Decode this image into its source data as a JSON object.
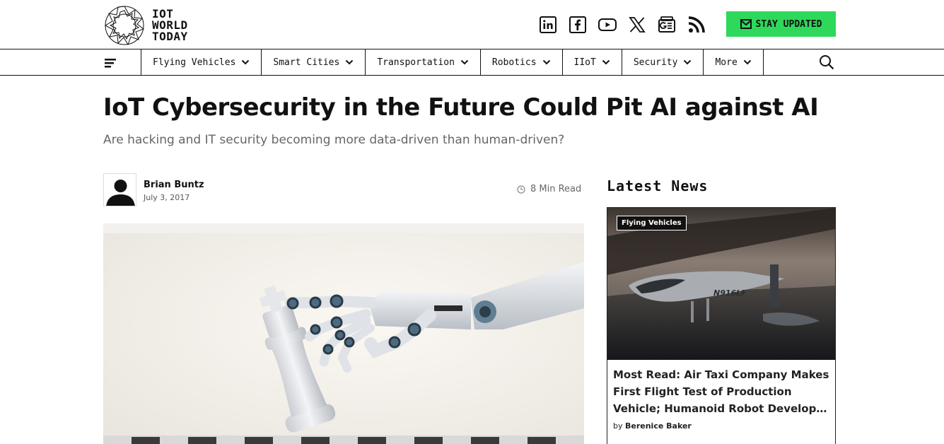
{
  "brand": {
    "logo_lines": [
      "IOT",
      "WORLD",
      "TODAY"
    ]
  },
  "socials": [
    {
      "icon": "linkedin-icon"
    },
    {
      "icon": "facebook-icon"
    },
    {
      "icon": "youtube-icon"
    },
    {
      "icon": "x-icon"
    },
    {
      "icon": "google-news-icon"
    },
    {
      "icon": "rss-icon"
    }
  ],
  "stay_updated": {
    "label": "STAY UPDATED",
    "color": "#2ed85b"
  },
  "nav": {
    "items": [
      {
        "label": "Flying Vehicles"
      },
      {
        "label": "Smart Cities"
      },
      {
        "label": "Transportation"
      },
      {
        "label": "Robotics"
      },
      {
        "label": "IIoT"
      },
      {
        "label": "Security"
      },
      {
        "label": "More"
      }
    ]
  },
  "article": {
    "title": "IoT Cybersecurity in the Future Could Pit AI against AI",
    "subtitle": "Are hacking and IT security becoming more data-driven than human-driven?",
    "author": "Brian Buntz",
    "date": "July 3, 2017",
    "read_time": "8 Min Read"
  },
  "sidebar": {
    "title": "Latest News",
    "card": {
      "tag": "Flying Vehicles",
      "headline": "Most Read: Air Taxi Company Makes First Flight Test of Production Vehicle; Humanoid Robot Developed by Electric Vehicle Maker",
      "by_label": "by",
      "author": "Berenice Baker",
      "plane_registration": "N916LF"
    }
  }
}
